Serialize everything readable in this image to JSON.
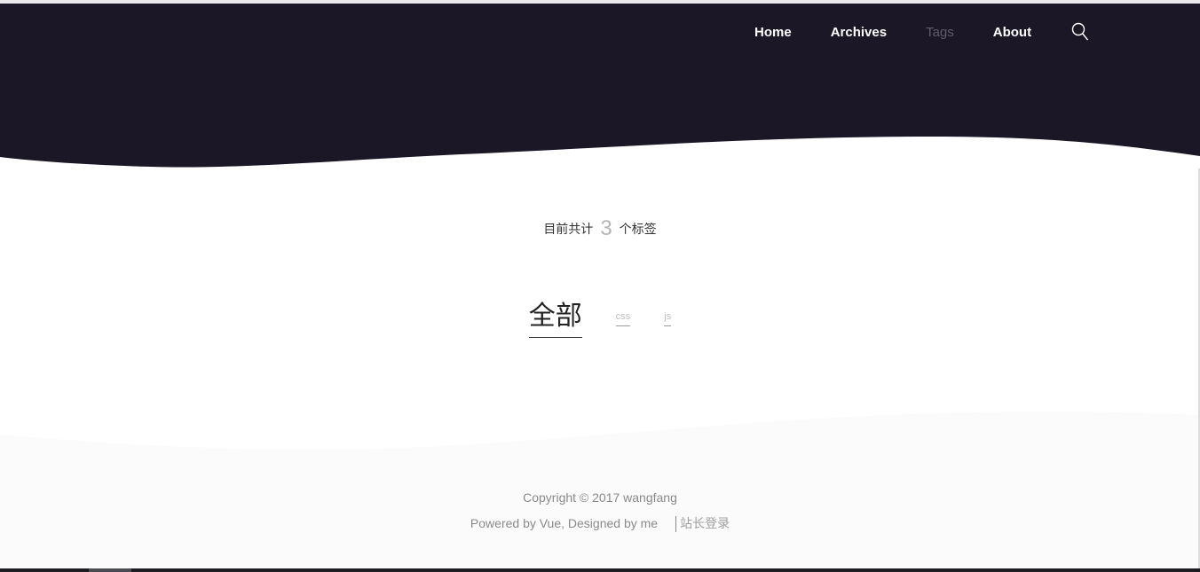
{
  "nav": {
    "items": [
      {
        "label": "Home",
        "active": false
      },
      {
        "label": "Archives",
        "active": false
      },
      {
        "label": "Tags",
        "active": true
      },
      {
        "label": "About",
        "active": false
      }
    ],
    "search_icon": "search-icon"
  },
  "summary": {
    "prefix": "目前共计",
    "count": "3",
    "suffix": "个标签"
  },
  "tags": {
    "all_label": "全部",
    "items": [
      "css",
      "js"
    ]
  },
  "footer": {
    "copyright": "Copyright © 2017 wangfang",
    "powered": "Powered by Vue, Designed by me",
    "admin_link": "站长登录"
  },
  "colors": {
    "header_bg": "#1b1726",
    "footer_bg": "#fbfbfc",
    "active_nav": "#5f5d6b"
  }
}
